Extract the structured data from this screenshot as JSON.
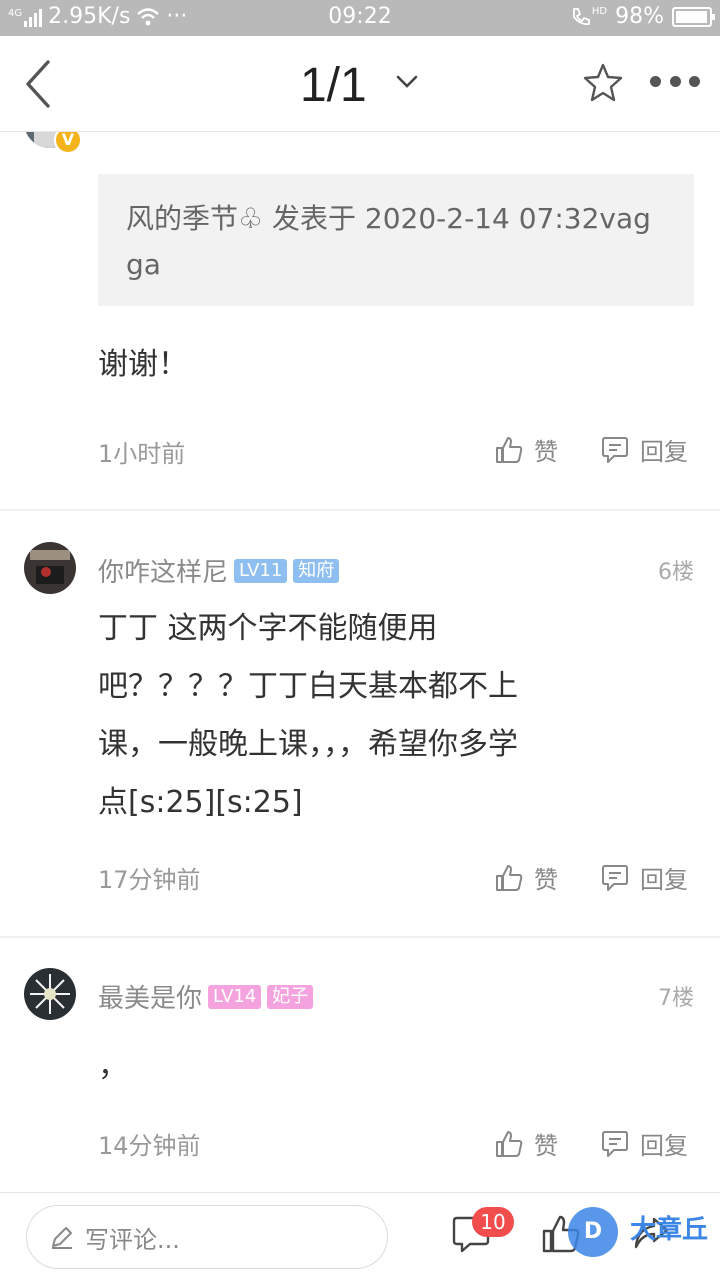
{
  "status_bar": {
    "network": "4G",
    "speed": "2.95K/s",
    "more": "···",
    "time": "09:22",
    "hd": "HD",
    "battery": "98%",
    "battery_level": 0.98
  },
  "nav": {
    "title": "1/1"
  },
  "post_top": {
    "vip_badge": "V",
    "quote": "风的季节♧ 发表于 2020-2-14 07:32vagga",
    "text": "谢谢！",
    "time": "1小时前",
    "like_label": "赞",
    "reply_label": "回复"
  },
  "posts": [
    {
      "username": "你咋这样尼",
      "level": "LV11",
      "title_badge": "知府",
      "floor": "6楼",
      "lines": [
        "丁丁 这两个字不能随便用",
        "吧？？？？丁丁白天基本都不上",
        "课，一般晚上课，，，希望你多学",
        "点[s:25][s:25]"
      ],
      "time": "17分钟前",
      "like_label": "赞",
      "reply_label": "回复",
      "badge_color": "#8fbff0"
    },
    {
      "username": "最美是你",
      "level": "LV14",
      "title_badge": "妃子",
      "floor": "7楼",
      "lines": [
        "，"
      ],
      "time": "14分钟前",
      "like_label": "赞",
      "reply_label": "回复",
      "badge_color": "#f4a3de"
    }
  ],
  "bottom_bar": {
    "comment_placeholder": "写评论...",
    "comment_count": "10",
    "watermark_logo": "D",
    "watermark_text": "大章丘"
  }
}
